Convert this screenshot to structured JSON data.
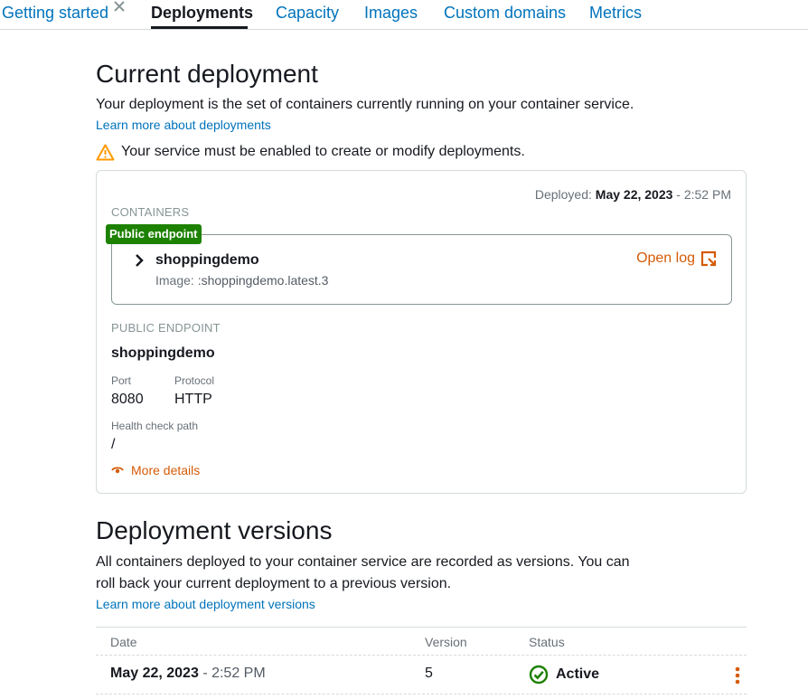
{
  "tabs": [
    {
      "label": "Getting started"
    },
    {
      "label": "Deployments"
    },
    {
      "label": "Capacity"
    },
    {
      "label": "Images"
    },
    {
      "label": "Custom domains"
    },
    {
      "label": "Metrics"
    }
  ],
  "current": {
    "title": "Current deployment",
    "description": "Your deployment is the set of containers currently running on your container service.",
    "learn_more": "Learn more about deployments",
    "warning": "Your service must be enabled to create or modify deployments.",
    "deployed_label": "Deployed:",
    "deployed_date": "May 22, 2023",
    "deployed_time": "- 2:52 PM",
    "containers_label": "CONTAINERS",
    "public_endpoint_badge": "Public endpoint",
    "container_name": "shoppingdemo",
    "image_label": "Image:",
    "image_value": ":shoppingdemo.latest.3",
    "open_log": "Open log",
    "public_endpoint_label": "PUBLIC ENDPOINT",
    "endpoint_name": "shoppingdemo",
    "port_label": "Port",
    "port_value": "8080",
    "protocol_label": "Protocol",
    "protocol_value": "HTTP",
    "health_label": "Health check path",
    "health_value": "/",
    "more_details": "More details"
  },
  "versions": {
    "title": "Deployment versions",
    "description_line1": "All containers deployed to your container service are recorded as versions. You can",
    "description_line2": "roll back your current deployment to a previous version.",
    "learn_more": "Learn more about deployment versions",
    "columns": {
      "date": "Date",
      "version": "Version",
      "status": "Status"
    },
    "rows": [
      {
        "date": "May 22, 2023",
        "time": "- 2:52 PM",
        "version": "5",
        "status": "Active"
      }
    ]
  },
  "colors": {
    "link": "#0073bb",
    "accent_orange": "#d45b07",
    "success_green": "#1d8102",
    "warning_orange": "#ff9900"
  },
  "icons": [
    "close-icon",
    "warning-icon",
    "chevron-right-icon",
    "external-log-icon",
    "eye-icon",
    "check-circle-icon",
    "kebab-menu-icon"
  ]
}
